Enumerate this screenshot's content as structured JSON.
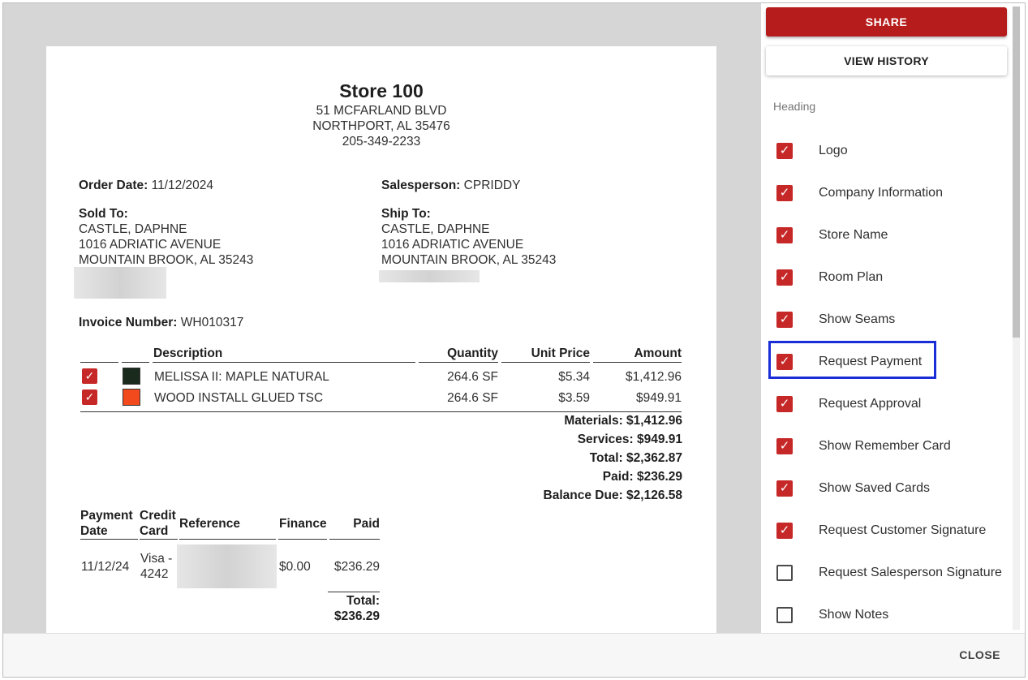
{
  "store": {
    "name": "Store 100",
    "address1": "51 MCFARLAND BLVD",
    "address2": "NORTHPORT, AL 35476",
    "phone": "205-349-2233"
  },
  "order": {
    "order_date_label": "Order Date:",
    "order_date": "11/12/2024",
    "salesperson_label": "Salesperson:",
    "salesperson": "CPRIDDY",
    "sold_to_label": "Sold To:",
    "sold_to": [
      "CASTLE, DAPHNE",
      "1016 ADRIATIC AVENUE",
      "MOUNTAIN BROOK, AL 35243"
    ],
    "ship_to_label": "Ship To:",
    "ship_to": [
      "CASTLE, DAPHNE",
      "1016 ADRIATIC AVENUE",
      "MOUNTAIN BROOK, AL 35243"
    ],
    "invoice_label": "Invoice Number:",
    "invoice_number": "WH010317"
  },
  "items_table": {
    "headers": [
      "Description",
      "Quantity",
      "Unit Price",
      "Amount"
    ],
    "rows": [
      {
        "checked": true,
        "swatch": "#1a2a1d",
        "description": "MELISSA II: MAPLE NATURAL",
        "quantity": "264.6 SF",
        "unit_price": "$5.34",
        "amount": "$1,412.96"
      },
      {
        "checked": true,
        "swatch": "#f24a1d",
        "description": "WOOD INSTALL GLUED TSC",
        "quantity": "264.6 SF",
        "unit_price": "$3.59",
        "amount": "$949.91"
      }
    ]
  },
  "totals": {
    "materials": "Materials: $1,412.96",
    "services": "Services: $949.91",
    "total": "Total: $2,362.87",
    "paid": "Paid: $236.29",
    "balance": "Balance Due: $2,126.58"
  },
  "payments": {
    "headers": {
      "date_1": "Payment",
      "date_2": "Date",
      "card_1": "Credit",
      "card_2": "Card",
      "reference": "Reference",
      "finance": "Finance",
      "paid": "Paid"
    },
    "rows": [
      {
        "date": "11/12/24",
        "card_1": "Visa -",
        "card_2": "4242",
        "finance": "$0.00",
        "paid": "$236.29"
      }
    ],
    "total_label": "Total:",
    "total_value": "$236.29"
  },
  "panel": {
    "share_label": "SHARE",
    "history_label": "VIEW HISTORY",
    "section_title": "Heading",
    "options": [
      {
        "label": "Logo",
        "checked": true
      },
      {
        "label": "Company Information",
        "checked": true
      },
      {
        "label": "Store Name",
        "checked": true
      },
      {
        "label": "Room Plan",
        "checked": true
      },
      {
        "label": "Show Seams",
        "checked": true
      },
      {
        "label": "Request Payment",
        "checked": true
      },
      {
        "label": "Request Approval",
        "checked": true
      },
      {
        "label": "Show Remember Card",
        "checked": true
      },
      {
        "label": "Show Saved Cards",
        "checked": true
      },
      {
        "label": "Request Customer Signature",
        "checked": true
      },
      {
        "label": "Request Salesperson Signature",
        "checked": false
      },
      {
        "label": "Show Notes",
        "checked": false
      }
    ],
    "check_glyph": "✓"
  },
  "footer": {
    "close_label": "CLOSE"
  },
  "colors": {
    "accent": "#b71c1c",
    "checkbox": "#c62828",
    "highlight": "#1a2ed8"
  }
}
